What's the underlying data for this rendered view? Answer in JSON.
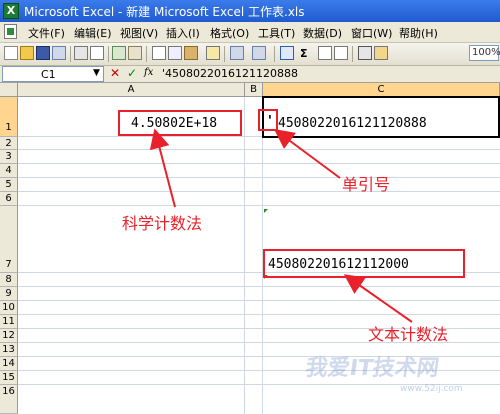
{
  "window": {
    "title": "Microsoft Excel - 新建 Microsoft Excel 工作表.xls"
  },
  "menu": [
    "文件(F)",
    "编辑(E)",
    "视图(V)",
    "插入(I)",
    "格式(O)",
    "工具(T)",
    "数据(D)",
    "窗口(W)",
    "帮助(H)"
  ],
  "toolbar": {
    "sum_symbol": "Σ",
    "zoom": "100%"
  },
  "formula_bar": {
    "name_box": "C1",
    "fx": "fx",
    "content": "'4508022016121120888"
  },
  "columns": [
    "A",
    "B",
    "C"
  ],
  "rows": [
    "1",
    "2",
    "3",
    "4",
    "5",
    "6",
    "7",
    "8",
    "9",
    "10",
    "11",
    "12",
    "13",
    "14",
    "15",
    "16"
  ],
  "cells": {
    "A1": "4.50802E+18",
    "C1_quote": "'",
    "C1": "4508022016121120888",
    "C7": "450802201612112000"
  },
  "annotations": {
    "quote": "单引号",
    "scientific": "科学计数法",
    "text": "文本计数法"
  },
  "watermark": {
    "main": "我爱IT技术网",
    "sub": "www.52ij.com"
  },
  "colors": {
    "annotation_red": "#e8212a",
    "header_bg": "#ece9d8",
    "selected_header": "#ffd58f"
  }
}
